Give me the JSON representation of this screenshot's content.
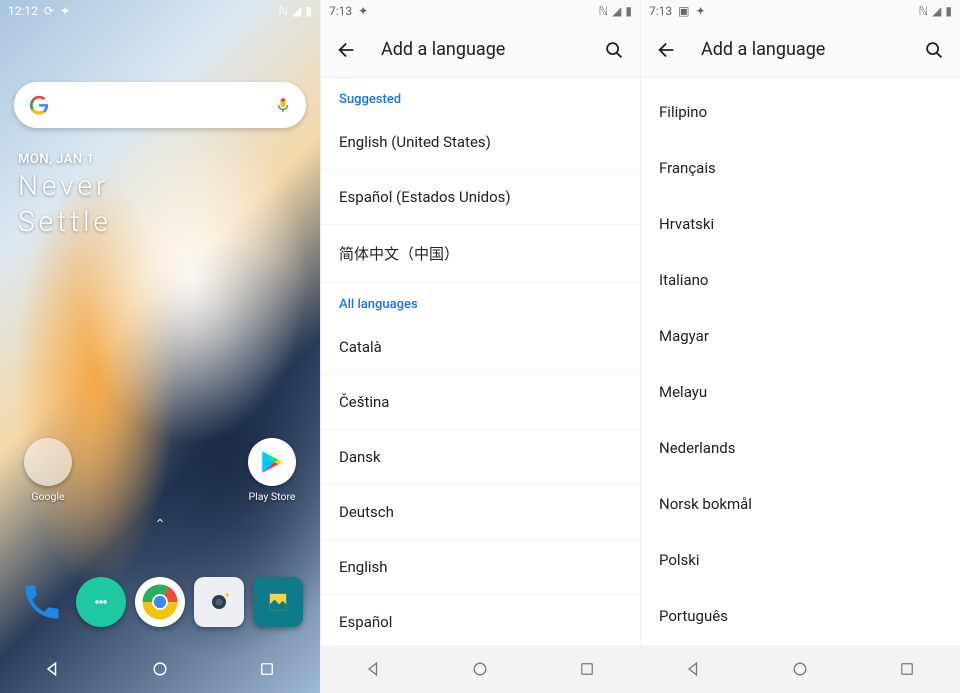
{
  "panel1": {
    "time": "12:12",
    "date": "MON, JAN 1",
    "slogan_line1": "Never",
    "slogan_line2": "Settle",
    "google_folder_label": "Google",
    "play_store_label": "Play Store",
    "dock_apps": [
      "phone",
      "messages",
      "chrome",
      "camera",
      "gallery"
    ]
  },
  "panel2": {
    "time": "7:13",
    "title": "Add a language",
    "section_suggested": "Suggested",
    "section_all": "All languages",
    "suggested": [
      "English (United States)",
      "Español (Estados Unidos)",
      "简体中文（中国）"
    ],
    "all": [
      "Català",
      "Čeština",
      "Dansk",
      "Deutsch",
      "English",
      "Español"
    ]
  },
  "panel3": {
    "time": "7:13",
    "title": "Add a language",
    "languages": [
      "Filipino",
      "Français",
      "Hrvatski",
      "Italiano",
      "Magyar",
      "Melayu",
      "Nederlands",
      "Norsk bokmål",
      "Polski",
      "Português"
    ]
  }
}
